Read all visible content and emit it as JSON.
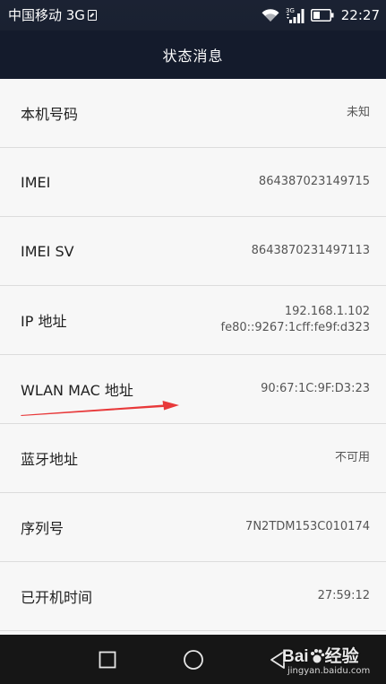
{
  "status_bar": {
    "carrier": "中国移动 3G",
    "network_badge": "3G",
    "time": "22:27",
    "icons": [
      "sim-icon",
      "wifi-icon",
      "signal-icon",
      "battery-icon"
    ]
  },
  "title": "状态消息",
  "rows": [
    {
      "label": "本机号码",
      "values": [
        "未知"
      ]
    },
    {
      "label": "IMEI",
      "values": [
        "864387023149715"
      ]
    },
    {
      "label": "IMEI SV",
      "values": [
        "8643870231497113"
      ]
    },
    {
      "label": "IP 地址",
      "values": [
        "192.168.1.102",
        "fe80::9267:1cff:fe9f:d323"
      ]
    },
    {
      "label": "WLAN MAC 地址",
      "values": [
        "90:67:1C:9F:D3:23"
      ]
    },
    {
      "label": "蓝牙地址",
      "values": [
        "不可用"
      ]
    },
    {
      "label": "序列号",
      "values": [
        "7N2TDM153C010174"
      ]
    },
    {
      "label": "已开机时间",
      "values": [
        "27:59:12"
      ]
    }
  ],
  "nav_bar": {
    "icons": [
      "recent-apps-icon",
      "home-icon",
      "back-icon"
    ]
  },
  "watermark": {
    "brand_left": "Bai",
    "brand_right": "经验",
    "url": "jingyan.baidu.com"
  },
  "colors": {
    "header": "#141b2c",
    "list_background": "#f7f7f7",
    "divider": "#dcdcdc",
    "annotation_arrow": "#e8393a",
    "nav_bar": "#161616"
  }
}
